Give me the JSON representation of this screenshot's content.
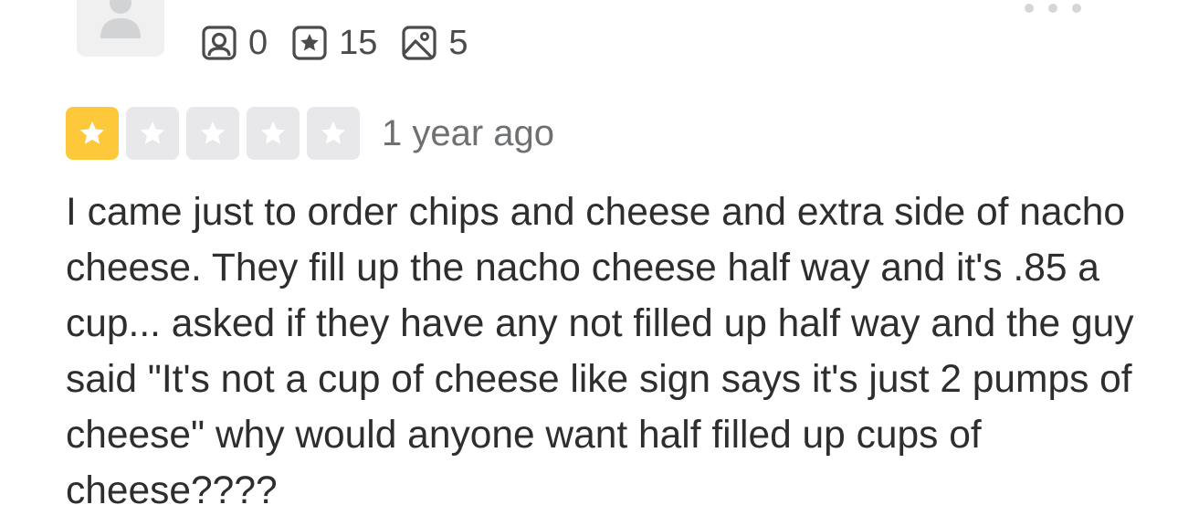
{
  "reviewer": {
    "avatar_icon": "user-silhouette-icon",
    "stats": [
      {
        "icon": "friends-icon",
        "count": "0"
      },
      {
        "icon": "reviews-star-icon",
        "count": "15"
      },
      {
        "icon": "photos-icon",
        "count": "5"
      }
    ]
  },
  "menu": {
    "icon": "more-options-icon"
  },
  "review": {
    "rating": 1,
    "rating_max": 5,
    "date": "1 year ago",
    "text": "I came just to order chips and cheese and extra side of nacho cheese. They fill up the nacho cheese half way and it's .85 a cup... asked if they have any not filled up half way and the guy said \"It's not a cup of cheese like sign says it's just 2 pumps of cheese\" why would anyone want half filled up cups of cheese????"
  },
  "colors": {
    "star_filled": "#fdc839",
    "star_empty": "#e8e8ea",
    "text": "#2d2e2f",
    "muted": "#6e7072"
  }
}
